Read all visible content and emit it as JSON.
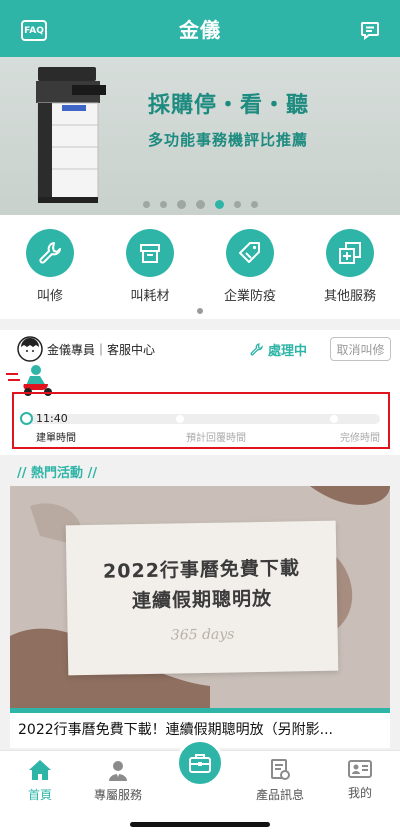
{
  "header": {
    "title": "金儀",
    "faq_label": "FAQ"
  },
  "banner": {
    "headline": "採購停・看・聽",
    "subline": "多功能事務機評比推薦",
    "slide_count": 7,
    "active_slide": 6
  },
  "quick_actions": [
    {
      "label": "叫修",
      "icon": "wrench-icon"
    },
    {
      "label": "叫耗材",
      "icon": "box-icon"
    },
    {
      "label": "企業防疫",
      "icon": "tag-icon"
    },
    {
      "label": "其他服務",
      "icon": "add-window-icon"
    }
  ],
  "service": {
    "agent": "金儀專員｜客服中心",
    "status": "處理中",
    "cancel_label": "取消叫修",
    "start_time": "11:40",
    "steps": [
      "建單時間",
      "預計回覆時間",
      "完修時間"
    ]
  },
  "hot_section": {
    "title": "熱門活動"
  },
  "article": {
    "line1": "2022行事曆免費下載",
    "line2": "連續假期聰明放",
    "script_text": "365 days",
    "title": "2022行事曆免費下載！連續假期聰明放（另附影..."
  },
  "bottom_nav": [
    {
      "label": "首頁",
      "icon": "home-icon",
      "active": true
    },
    {
      "label": "專屬服務",
      "icon": "agent-icon",
      "active": false
    },
    {
      "label": "產品訊息",
      "icon": "product-doc-icon",
      "active": false
    },
    {
      "label": "我的",
      "icon": "id-card-icon",
      "active": false
    }
  ],
  "colors": {
    "accent": "#2fb5a8",
    "highlight_border": "#e0141e"
  }
}
